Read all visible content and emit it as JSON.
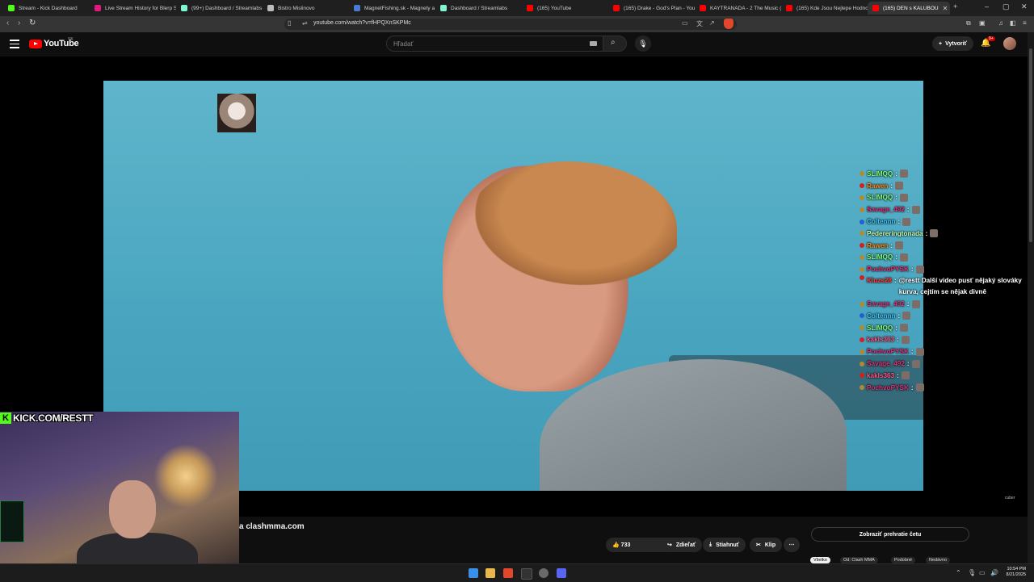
{
  "browser": {
    "tabs": [
      {
        "title": "Stream - Kick Dashboard",
        "color": "#53fc18",
        "active": false
      },
      {
        "title": "Live Stream History for Blerp S",
        "color": "#e0197d",
        "active": false
      },
      {
        "title": "(99+) Dashboard / Streamlabs",
        "color": "#80f5d2",
        "active": false
      },
      {
        "title": "Bistro Mislinovo",
        "color": "#bbbbbb",
        "active": false
      },
      {
        "title": "MagnetFishing.sk - Magnety a",
        "color": "#4a7bd0",
        "active": false
      },
      {
        "title": "Dashboard / Streamlabs",
        "color": "#80f5d2",
        "active": false
      },
      {
        "title": "(165) YouTube",
        "color": "#ff0000",
        "active": false
      },
      {
        "title": "(165) Drake - God's Plan - You",
        "color": "#ff0000",
        "active": false
      },
      {
        "title": "KAYTRANADA - 2 The Music (",
        "color": "#ff0000",
        "active": false
      },
      {
        "title": "(165) Kde Jsou Nejlepe Hodno",
        "color": "#ff0000",
        "active": false
      },
      {
        "title": "(165) DEN s KALUBOU",
        "color": "#ff0000",
        "active": true
      }
    ],
    "new_tab": "+",
    "window_controls": [
      "–",
      "▢",
      "✕"
    ],
    "url": "youtube.com/watch?v=fHPQXnSKPMc"
  },
  "youtube": {
    "logo_text": "YouTube",
    "country": "SK",
    "search_placeholder": "Hľadať",
    "create_label": "Vytvoriť",
    "notification_count": "9+"
  },
  "chat": [
    {
      "user": "SLIMQQ",
      "user_color": "#7fff7f",
      "badge": "#b08a30",
      "message": "",
      "emote": true
    },
    {
      "user": "Rawen",
      "user_color": "#ff8c1a",
      "badge": "#d02020",
      "message": "",
      "emote": true
    },
    {
      "user": "SLIMQQ",
      "user_color": "#7fff7f",
      "badge": "#b08a30",
      "message": "",
      "emote": true
    },
    {
      "user": "Savage_492",
      "user_color": "#e0357a",
      "badge": "#b08a30",
      "message": "",
      "emote": true
    },
    {
      "user": "Coltennn",
      "user_color": "#3cc7ff",
      "badge": "#2060d0",
      "message": "",
      "emote": true
    },
    {
      "user": "Pedereringtonada",
      "user_color": "#c8ffb0",
      "badge": "#b08a30",
      "message": "",
      "emote": true
    },
    {
      "user": "Rawen",
      "user_color": "#ff8c1a",
      "badge": "#d02020",
      "message": "",
      "emote": true
    },
    {
      "user": "SLIMQQ",
      "user_color": "#7fff7f",
      "badge": "#b08a30",
      "message": "",
      "emote": true
    },
    {
      "user": "PochvoPYSK",
      "user_color": "#e0357a",
      "badge": "#b08a30",
      "message": "",
      "emote": true
    },
    {
      "user": "Kluzs28",
      "user_color": "#ff3d3d",
      "badge": "#d02020",
      "message": "@restt Další video pusť nějaký slováky kurva, cejtím se nějak divně",
      "emote": false
    },
    {
      "user": "Savage_492",
      "user_color": "#e0357a",
      "badge": "#b08a30",
      "message": "",
      "emote": true
    },
    {
      "user": "Coltennn",
      "user_color": "#3cc7ff",
      "badge": "#2060d0",
      "message": "",
      "emote": true
    },
    {
      "user": "SLIMQQ",
      "user_color": "#7fff7f",
      "badge": "#b08a30",
      "message": "",
      "emote": true
    },
    {
      "user": "kakls363",
      "user_color": "#ff5a8a",
      "badge": "#d02020",
      "message": "",
      "emote": true
    },
    {
      "user": "PochvoPYSK",
      "user_color": "#e0357a",
      "badge": "#b08a30",
      "message": "",
      "emote": true
    },
    {
      "user": "Savage_492",
      "user_color": "#e0357a",
      "badge": "#b08a30",
      "message": "",
      "emote": true
    },
    {
      "user": "kakls363",
      "user_color": "#ff5a8a",
      "badge": "#d02020",
      "message": "",
      "emote": true
    },
    {
      "user": "PochvoPYSK",
      "user_color": "#e0357a",
      "badge": "#b08a30",
      "message": "",
      "emote": true
    }
  ],
  "overlay": {
    "kick_label": "KICK.COM/RESTT",
    "kick_color": "#53fc18",
    "corner_watermark": "cuber"
  },
  "video": {
    "title_fragment": "a clashmma.com",
    "likes": "733",
    "share_label": "Zdieľať",
    "download_label": "Stiahnuť",
    "clip_label": "Klip",
    "chat_replay_label": "Zobraziť prehratie četu"
  },
  "chips": [
    "Všetko",
    "Od: Clash MMA",
    "Podobné",
    "Nedávno"
  ],
  "taskbar": {
    "time": "10:54 PM",
    "date": "8/21/2025"
  }
}
